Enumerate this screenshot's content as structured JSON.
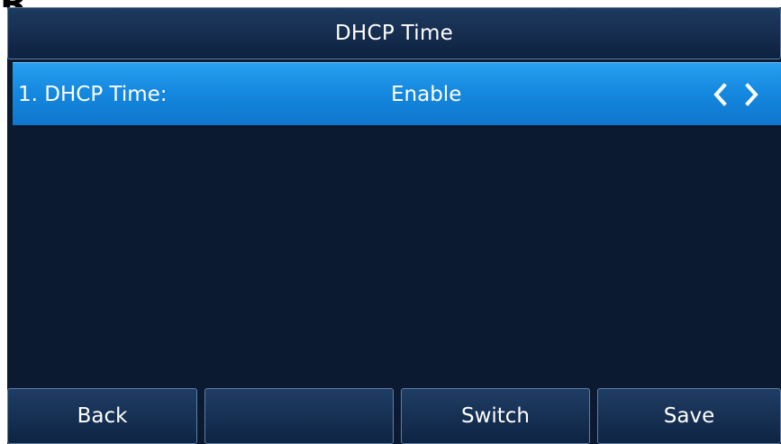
{
  "title": "DHCP Time",
  "settings": [
    {
      "label": "1. DHCP Time:",
      "value": "Enable"
    }
  ],
  "icons": {
    "prev": "chevron-left-icon",
    "next": "chevron-right-icon"
  },
  "softkeys": {
    "key1": "Back",
    "key2": "",
    "key3": "Switch",
    "key4": "Save"
  },
  "colors": {
    "background": "#0b1a30",
    "selected_row": "#1589e0",
    "text": "#ffffff"
  }
}
